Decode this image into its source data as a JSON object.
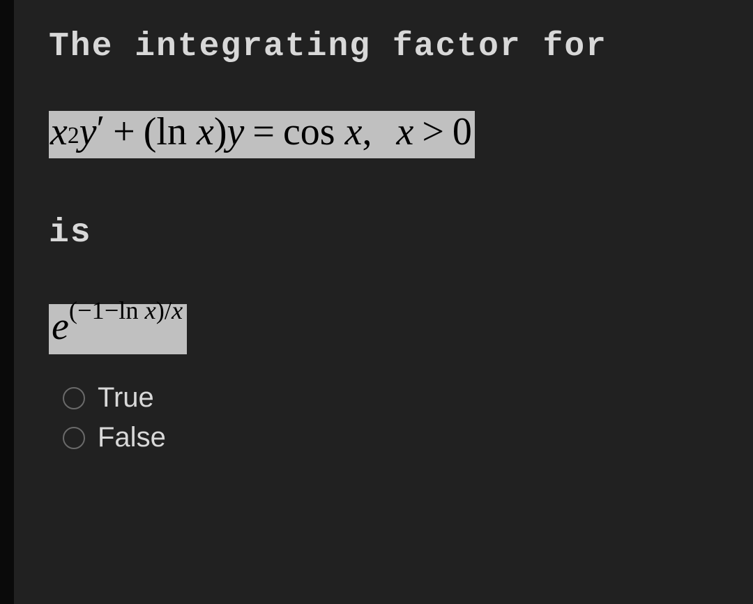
{
  "question": {
    "intro": "The integrating factor for",
    "equation_parts": {
      "x": "x",
      "sq": "2",
      "y": "y",
      "prime": "′",
      "plus": "+",
      "lparen": "(",
      "ln": "ln",
      "rparen": ")",
      "eq": "=",
      "cos": "cos",
      "comma": ",",
      "gt": ">",
      "zero": "0"
    },
    "is": "is",
    "answer_parts": {
      "e": "e",
      "exp": "(−1−ln ",
      "exp_x": "x",
      "exp_tail": ")/",
      "exp_x2": "x"
    }
  },
  "options": {
    "true": "True",
    "false": "False"
  }
}
